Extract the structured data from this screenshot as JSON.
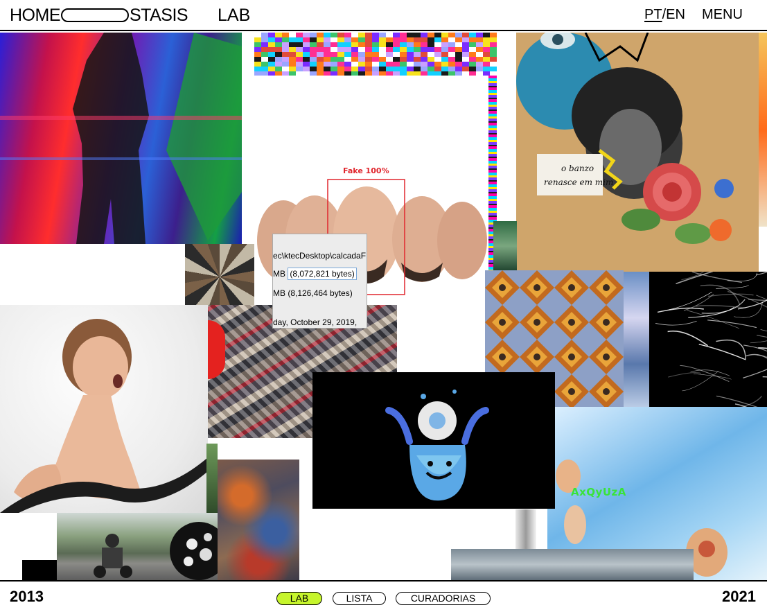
{
  "header": {
    "logo_left": "HOME",
    "logo_right": "STASIS",
    "section_title": "LAB",
    "lang_pt": "PT",
    "lang_sep": "/",
    "lang_en": "EN",
    "menu_label": "MENU"
  },
  "collage": {
    "deepfake_caption": "Fake 100%",
    "file_path": "ec\\ktecDesktop\\calcadaF",
    "size_line_1_prefix": "MB",
    "size_line_1_value": "(8,072,821 bytes)",
    "size_line_2": "MB (8,126,464 bytes)",
    "date_line": "day, October 29, 2019,",
    "overlay_code": "AxQyUzA"
  },
  "footer": {
    "year_start": "2013",
    "year_end": "2021",
    "tabs": [
      {
        "label": "LAB",
        "active": true
      },
      {
        "label": "LISTA",
        "active": false
      },
      {
        "label": "CURADORIAS",
        "active": false
      }
    ]
  },
  "colors": {
    "active_tab": "#c6f52c",
    "overlay_code": "#39e33a",
    "deepfake_box": "#e0262d"
  }
}
